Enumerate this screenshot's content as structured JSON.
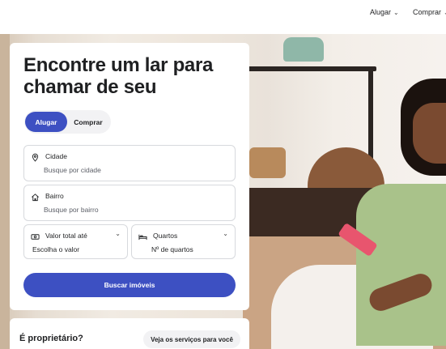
{
  "topnav": {
    "rent_label": "Alugar",
    "buy_label": "Comprar"
  },
  "hero_card": {
    "headline": "Encontre um lar para chamar de seu",
    "mode_toggle": {
      "active": "Alugar",
      "inactive": "Comprar"
    },
    "city_field": {
      "label": "Cidade",
      "placeholder": "Busque por cidade",
      "icon": "location-pin-icon"
    },
    "neighborhood_field": {
      "label": "Bairro",
      "placeholder": "Busque por bairro",
      "icon": "house-icon"
    },
    "price_field": {
      "label": "Valor total até",
      "value": "Escolha o valor",
      "icon": "money-icon"
    },
    "rooms_field": {
      "label": "Quartos",
      "value": "Nº de quartos",
      "icon": "bed-icon"
    },
    "search_button": "Buscar imóveis"
  },
  "owner_banner": {
    "question": "É proprietário?",
    "services_button": "Veja os serviços para você"
  },
  "colors": {
    "primary": "#3d50c2",
    "text": "#1f2022",
    "muted_text": "#5d6068",
    "border": "#d7d9dd",
    "pill_bg": "#f2f2f4"
  }
}
